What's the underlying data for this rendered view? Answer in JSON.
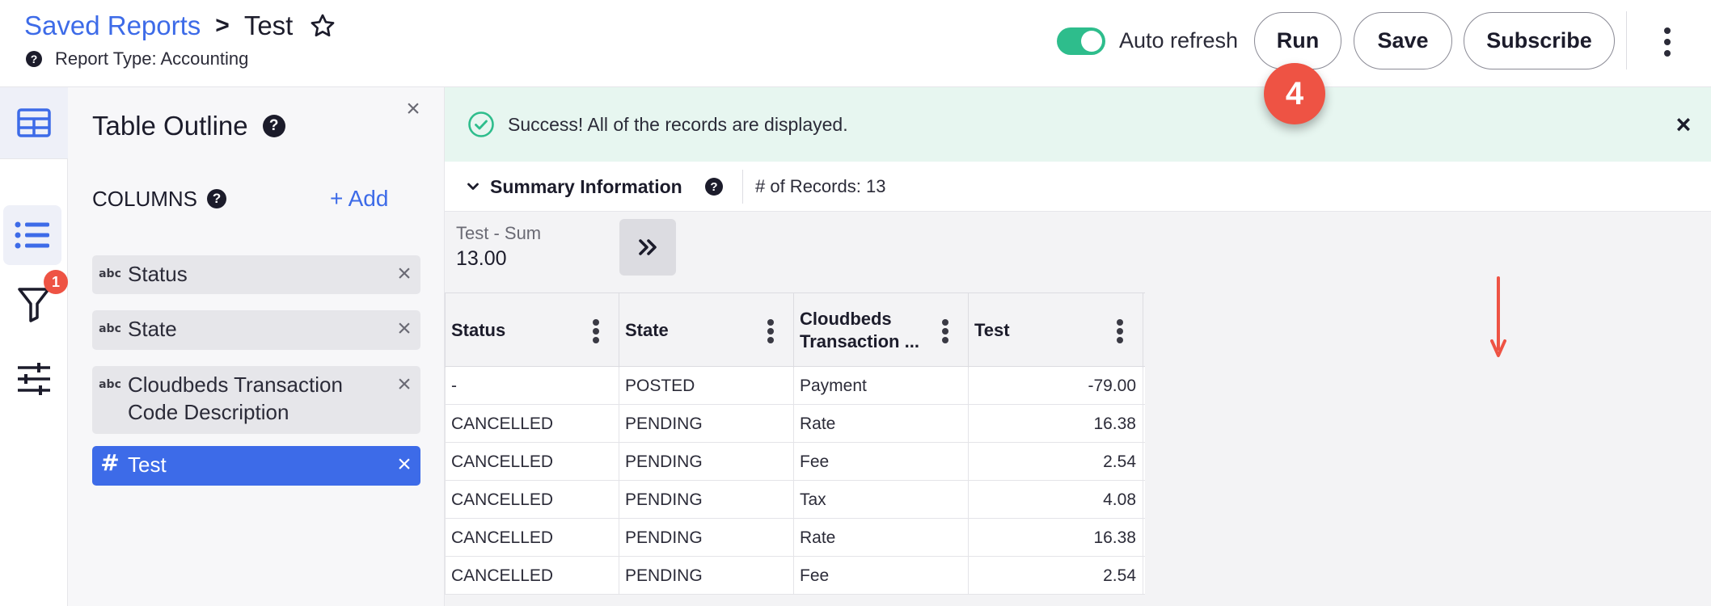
{
  "header": {
    "breadcrumb_link": "Saved Reports",
    "breadcrumb_sep": ">",
    "breadcrumb_current": "Test",
    "report_type": "Report Type: Accounting",
    "auto_refresh_label": "Auto refresh",
    "auto_refresh_on": true,
    "run_label": "Run",
    "save_label": "Save",
    "subscribe_label": "Subscribe",
    "step_badge": "4"
  },
  "rail": {
    "filter_badge": "1"
  },
  "outline": {
    "title": "Table Outline",
    "columns_heading": "COLUMNS",
    "add_label": "+ Add",
    "close_glyph": "×",
    "columns": [
      {
        "type": "abc",
        "label": "Status"
      },
      {
        "type": "abc",
        "label": "State"
      },
      {
        "type": "abc",
        "label": "Cloudbeds Transaction Code Description"
      },
      {
        "type": "#",
        "label": "Test",
        "selected": true
      }
    ]
  },
  "main": {
    "success_message": "Success! All of the records are displayed.",
    "summary_title": "Summary Information",
    "records_label": "# of Records: 13",
    "metric_label": "Test - Sum",
    "metric_value": "13.00",
    "table": {
      "headers": [
        "Status",
        "State",
        "Cloudbeds Transaction ...",
        "Test"
      ],
      "rows": [
        [
          "-",
          "POSTED",
          "Payment",
          "-79.00"
        ],
        [
          "CANCELLED",
          "PENDING",
          "Rate",
          "16.38"
        ],
        [
          "CANCELLED",
          "PENDING",
          "Fee",
          "2.54"
        ],
        [
          "CANCELLED",
          "PENDING",
          "Tax",
          "4.08"
        ],
        [
          "CANCELLED",
          "PENDING",
          "Rate",
          "16.38"
        ],
        [
          "CANCELLED",
          "PENDING",
          "Fee",
          "2.54"
        ]
      ]
    }
  },
  "colors": {
    "accent": "#3d6be8",
    "success_bg": "#e7f6f0",
    "success_icon": "#2ebd8c",
    "toggle_on": "#2ebd8c",
    "badge_red": "#ee5344",
    "annotation_arrow": "#ee5344"
  },
  "icons": {
    "star": "star-icon",
    "help": "question-circle-icon",
    "table": "table-grid-icon",
    "list": "list-icon",
    "filter": "filter-icon",
    "sliders": "sliders-icon",
    "close": "close-icon",
    "check": "check-circle-icon",
    "chevron": "chevron-down-icon",
    "expand": "double-chevron-right-icon",
    "more": "kebab-vertical-icon"
  }
}
